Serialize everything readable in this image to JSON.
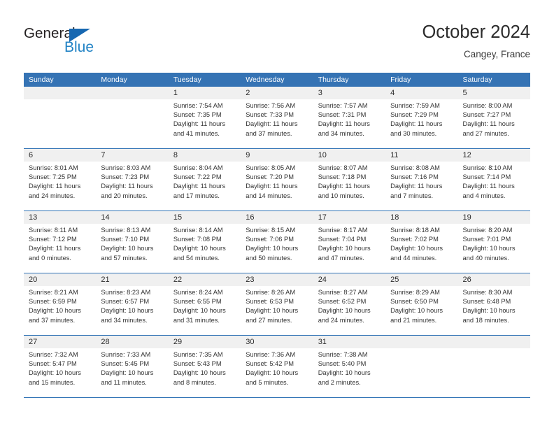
{
  "brand": {
    "name_top": "General",
    "name_bottom": "Blue",
    "accent_color": "#2283c5",
    "triangle_color": "#1667b1"
  },
  "header": {
    "month_title": "October 2024",
    "location": "Cangey, France"
  },
  "calendar": {
    "header_color": "#3573b4",
    "grid_line_color": "#2f72b5",
    "day_band_color": "#f0f0f0",
    "weekdays": [
      "Sunday",
      "Monday",
      "Tuesday",
      "Wednesday",
      "Thursday",
      "Friday",
      "Saturday"
    ],
    "weeks": [
      [
        {
          "empty": true
        },
        {
          "empty": true
        },
        {
          "day": "1",
          "sunrise": "Sunrise: 7:54 AM",
          "sunset": "Sunset: 7:35 PM",
          "daylight": "Daylight: 11 hours and 41 minutes."
        },
        {
          "day": "2",
          "sunrise": "Sunrise: 7:56 AM",
          "sunset": "Sunset: 7:33 PM",
          "daylight": "Daylight: 11 hours and 37 minutes."
        },
        {
          "day": "3",
          "sunrise": "Sunrise: 7:57 AM",
          "sunset": "Sunset: 7:31 PM",
          "daylight": "Daylight: 11 hours and 34 minutes."
        },
        {
          "day": "4",
          "sunrise": "Sunrise: 7:59 AM",
          "sunset": "Sunset: 7:29 PM",
          "daylight": "Daylight: 11 hours and 30 minutes."
        },
        {
          "day": "5",
          "sunrise": "Sunrise: 8:00 AM",
          "sunset": "Sunset: 7:27 PM",
          "daylight": "Daylight: 11 hours and 27 minutes."
        }
      ],
      [
        {
          "day": "6",
          "sunrise": "Sunrise: 8:01 AM",
          "sunset": "Sunset: 7:25 PM",
          "daylight": "Daylight: 11 hours and 24 minutes."
        },
        {
          "day": "7",
          "sunrise": "Sunrise: 8:03 AM",
          "sunset": "Sunset: 7:23 PM",
          "daylight": "Daylight: 11 hours and 20 minutes."
        },
        {
          "day": "8",
          "sunrise": "Sunrise: 8:04 AM",
          "sunset": "Sunset: 7:22 PM",
          "daylight": "Daylight: 11 hours and 17 minutes."
        },
        {
          "day": "9",
          "sunrise": "Sunrise: 8:05 AM",
          "sunset": "Sunset: 7:20 PM",
          "daylight": "Daylight: 11 hours and 14 minutes."
        },
        {
          "day": "10",
          "sunrise": "Sunrise: 8:07 AM",
          "sunset": "Sunset: 7:18 PM",
          "daylight": "Daylight: 11 hours and 10 minutes."
        },
        {
          "day": "11",
          "sunrise": "Sunrise: 8:08 AM",
          "sunset": "Sunset: 7:16 PM",
          "daylight": "Daylight: 11 hours and 7 minutes."
        },
        {
          "day": "12",
          "sunrise": "Sunrise: 8:10 AM",
          "sunset": "Sunset: 7:14 PM",
          "daylight": "Daylight: 11 hours and 4 minutes."
        }
      ],
      [
        {
          "day": "13",
          "sunrise": "Sunrise: 8:11 AM",
          "sunset": "Sunset: 7:12 PM",
          "daylight": "Daylight: 11 hours and 0 minutes."
        },
        {
          "day": "14",
          "sunrise": "Sunrise: 8:13 AM",
          "sunset": "Sunset: 7:10 PM",
          "daylight": "Daylight: 10 hours and 57 minutes."
        },
        {
          "day": "15",
          "sunrise": "Sunrise: 8:14 AM",
          "sunset": "Sunset: 7:08 PM",
          "daylight": "Daylight: 10 hours and 54 minutes."
        },
        {
          "day": "16",
          "sunrise": "Sunrise: 8:15 AM",
          "sunset": "Sunset: 7:06 PM",
          "daylight": "Daylight: 10 hours and 50 minutes."
        },
        {
          "day": "17",
          "sunrise": "Sunrise: 8:17 AM",
          "sunset": "Sunset: 7:04 PM",
          "daylight": "Daylight: 10 hours and 47 minutes."
        },
        {
          "day": "18",
          "sunrise": "Sunrise: 8:18 AM",
          "sunset": "Sunset: 7:02 PM",
          "daylight": "Daylight: 10 hours and 44 minutes."
        },
        {
          "day": "19",
          "sunrise": "Sunrise: 8:20 AM",
          "sunset": "Sunset: 7:01 PM",
          "daylight": "Daylight: 10 hours and 40 minutes."
        }
      ],
      [
        {
          "day": "20",
          "sunrise": "Sunrise: 8:21 AM",
          "sunset": "Sunset: 6:59 PM",
          "daylight": "Daylight: 10 hours and 37 minutes."
        },
        {
          "day": "21",
          "sunrise": "Sunrise: 8:23 AM",
          "sunset": "Sunset: 6:57 PM",
          "daylight": "Daylight: 10 hours and 34 minutes."
        },
        {
          "day": "22",
          "sunrise": "Sunrise: 8:24 AM",
          "sunset": "Sunset: 6:55 PM",
          "daylight": "Daylight: 10 hours and 31 minutes."
        },
        {
          "day": "23",
          "sunrise": "Sunrise: 8:26 AM",
          "sunset": "Sunset: 6:53 PM",
          "daylight": "Daylight: 10 hours and 27 minutes."
        },
        {
          "day": "24",
          "sunrise": "Sunrise: 8:27 AM",
          "sunset": "Sunset: 6:52 PM",
          "daylight": "Daylight: 10 hours and 24 minutes."
        },
        {
          "day": "25",
          "sunrise": "Sunrise: 8:29 AM",
          "sunset": "Sunset: 6:50 PM",
          "daylight": "Daylight: 10 hours and 21 minutes."
        },
        {
          "day": "26",
          "sunrise": "Sunrise: 8:30 AM",
          "sunset": "Sunset: 6:48 PM",
          "daylight": "Daylight: 10 hours and 18 minutes."
        }
      ],
      [
        {
          "day": "27",
          "sunrise": "Sunrise: 7:32 AM",
          "sunset": "Sunset: 5:47 PM",
          "daylight": "Daylight: 10 hours and 15 minutes."
        },
        {
          "day": "28",
          "sunrise": "Sunrise: 7:33 AM",
          "sunset": "Sunset: 5:45 PM",
          "daylight": "Daylight: 10 hours and 11 minutes."
        },
        {
          "day": "29",
          "sunrise": "Sunrise: 7:35 AM",
          "sunset": "Sunset: 5:43 PM",
          "daylight": "Daylight: 10 hours and 8 minutes."
        },
        {
          "day": "30",
          "sunrise": "Sunrise: 7:36 AM",
          "sunset": "Sunset: 5:42 PM",
          "daylight": "Daylight: 10 hours and 5 minutes."
        },
        {
          "day": "31",
          "sunrise": "Sunrise: 7:38 AM",
          "sunset": "Sunset: 5:40 PM",
          "daylight": "Daylight: 10 hours and 2 minutes."
        },
        {
          "empty": true
        },
        {
          "empty": true
        }
      ]
    ]
  }
}
